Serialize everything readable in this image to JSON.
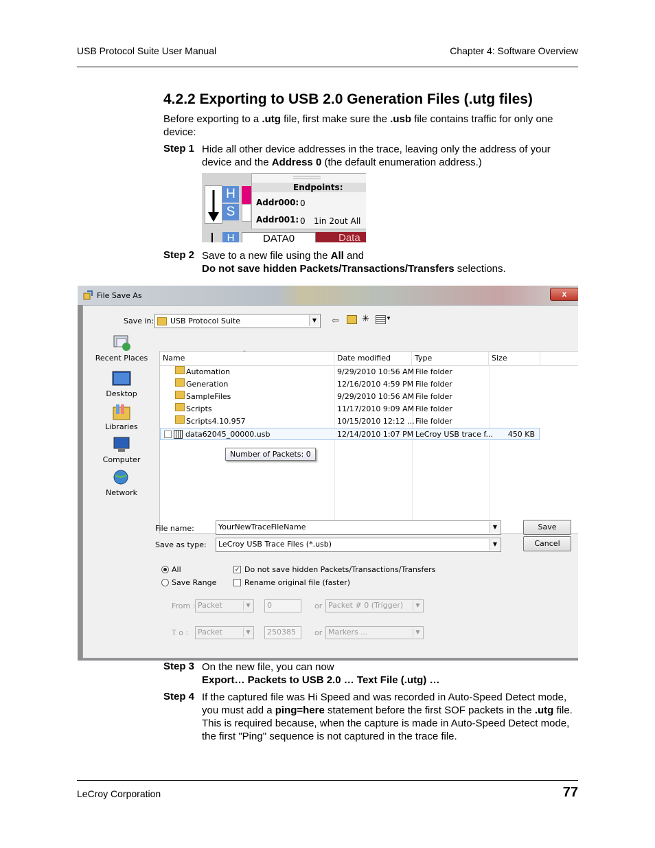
{
  "header": {
    "left": "USB Protocol Suite User Manual",
    "right": "Chapter 4: Software Overview"
  },
  "section_title": "4.2.2 Exporting to USB 2.0 Generation Files (.utg files)",
  "intro": {
    "a": "Before exporting to a ",
    "b": ".utg",
    "c": " file, first make sure the ",
    "d": ".usb",
    "e": " file contains traffic for only one",
    "f": "device:"
  },
  "step1": {
    "label": "Step 1",
    "line1": "Hide all other device addresses in the trace, leaving only the address of your",
    "line2a": "device and the ",
    "line2b": "Address 0",
    "line2c": " (the default enumeration address.)"
  },
  "snippet": {
    "h": "H",
    "s": "S",
    "h2": "H",
    "endpoints": "Endpoints:",
    "addr0": "Addr000:",
    "addr0_val": "0",
    "addr1": "Addr001:",
    "addr1_val": "0",
    "addr1_eps": "1in 2out  All",
    "data0": "DATA0",
    "data": "Data"
  },
  "step2": {
    "label": "Step 2",
    "line1a": "Save to a new file using the ",
    "line1b": "All",
    "line1c": " and",
    "line2a": "Do not save hidden Packets/Transactions/Transfers",
    "line2b": " selections."
  },
  "dialog": {
    "title": "File Save As",
    "close": "x",
    "save_in_label": "Save in:",
    "save_in_value": "USB Protocol Suite",
    "places": [
      "Recent Places",
      "Desktop",
      "Libraries",
      "Computer",
      "Network"
    ],
    "columns": [
      "Name",
      "Date modified",
      "Type",
      "Size"
    ],
    "rows": [
      {
        "name": "Automation",
        "date": "9/29/2010 10:56 AM",
        "type": "File folder",
        "size": ""
      },
      {
        "name": "Generation",
        "date": "12/16/2010 4:59 PM",
        "type": "File folder",
        "size": ""
      },
      {
        "name": "SampleFiles",
        "date": "9/29/2010 10:56 AM",
        "type": "File folder",
        "size": ""
      },
      {
        "name": "Scripts",
        "date": "11/17/2010 9:09 AM",
        "type": "File folder",
        "size": ""
      },
      {
        "name": "Scripts4.10.957",
        "date": "10/15/2010 12:12 ...",
        "type": "File folder",
        "size": ""
      },
      {
        "name": "data62045_00000.usb",
        "date": "12/14/2010 1:07 PM",
        "type": "LeCroy USB trace f...",
        "size": "450 KB"
      }
    ],
    "tooltip": "Number of Packets:  0",
    "file_name_label": "File name:",
    "file_name_value": "YourNewTraceFileName",
    "save_type_label": "Save as type:",
    "save_type_value": "LeCroy USB Trace Files (*.usb)",
    "save_button": "Save",
    "cancel_button": "Cancel",
    "radio_all": "All",
    "radio_range": "Save Range",
    "chk_hidden": "Do not save hidden Packets/Transactions/Transfers",
    "chk_rename": "Rename original file (faster)",
    "from_label": "From :",
    "to_label": "T o :",
    "from_unit": "Packet",
    "from_value": "0",
    "or1": "or",
    "from_alt": "Packet # 0 (Trigger)",
    "to_unit": "Packet",
    "to_value": "250385",
    "or2": "or",
    "to_alt": "Markers ..."
  },
  "step3": {
    "label": "Step 3",
    "line1": "On the new file, you can now",
    "line2": "Export… Packets to USB 2.0 … Text File (.utg) …"
  },
  "step4": {
    "label": "Step 4",
    "line1": "If the captured file was Hi Speed and was recorded in Auto-Speed Detect mode,",
    "line2a": "you must add a ",
    "line2b": "ping=here",
    "line2c": " statement before the first SOF packets in the ",
    "line2d": ".utg",
    "line2e": " file.",
    "line3": "This is required because, when the capture is made in Auto-Speed Detect mode,",
    "line4": "the first \"Ping\" sequence is not captured in the trace file."
  },
  "footer": {
    "left": "LeCroy Corporation",
    "page": "77"
  }
}
